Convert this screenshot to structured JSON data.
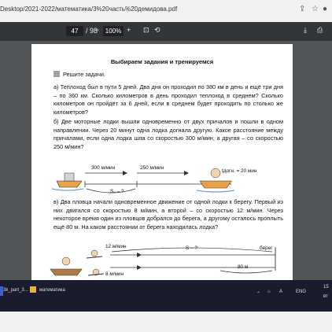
{
  "browser": {
    "url": "Desktop/2021-2022/математика/3%20часть%20демидова.pdf",
    "page_current": "47",
    "page_total": "/ 98",
    "zoom": "100%"
  },
  "doc": {
    "title": "Выбираем задания и тренируемся",
    "instruction": "Решите задачи.",
    "task_a": "а) Теплоход был в пути 5 дней. Два дня он проходил по 380 км в день и ещё три дня – по 360 км. Сколько километров в день проходил теплоход в среднем? Сколько километров он пройдёт за 6 дней, если в среднем будет проходить по столько же километров?",
    "task_b": "б) Две моторные лодки вышли одновременно от двух причалов и пошли в одном направлении. Через 20 минут одна лодка догнала другую. Какое расстояние между причалами, если одна лодка шла со скоростью 300 м/мин, а другая – со скоростью 250 м/мин?",
    "task_v": "в) Два пловца начали одновременное движение от одной лодки к берегу. Первый из них двигался со скоростью 8 м/мин, а второй – со скоростью 12 м/мин. Через некоторое время один из пловцов добрался до берега, а другому осталось проплыть ещё 80 м. На каком расстоянии от берега находилась лодка?",
    "fig_b": {
      "v1": "300 м/мин",
      "v2": "250 м/мин",
      "s0": "S₀ – ?",
      "t": "tдогн. = 20 мин"
    },
    "fig_v": {
      "v1": "12 м/мин",
      "v2": "8 м/мин",
      "s": "S – ?",
      "shore": "берег",
      "rest": "80 м"
    }
  },
  "taskbar": {
    "item1": "3k_part_3...",
    "item2": "математика",
    "lang": "ENG",
    "time": "15",
    "date": "вт"
  }
}
